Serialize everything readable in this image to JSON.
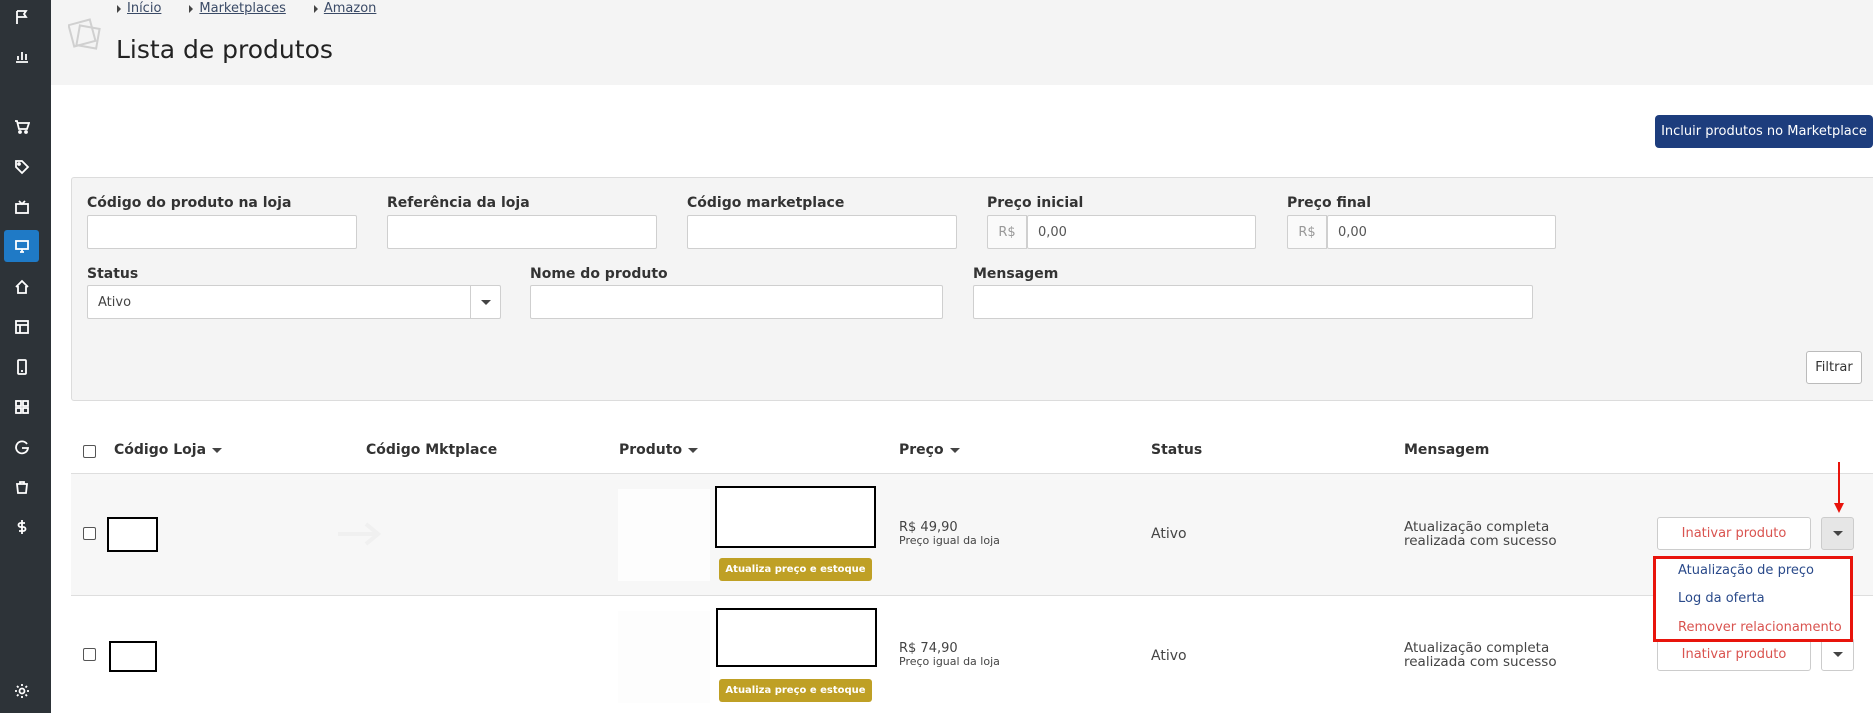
{
  "breadcrumb": [
    {
      "label": "Início"
    },
    {
      "label": "Marketplaces"
    },
    {
      "label": "Amazon"
    }
  ],
  "page_title": "Lista de produtos",
  "include_button": "Incluir produtos no Marketplace",
  "filters": {
    "store_code": {
      "label": "Código do produto na loja",
      "value": ""
    },
    "store_ref": {
      "label": "Referência da loja",
      "value": ""
    },
    "marketplace_code": {
      "label": "Código marketplace",
      "value": ""
    },
    "price_start": {
      "label": "Preço inicial",
      "prefix": "R$",
      "placeholder": "0,00"
    },
    "price_end": {
      "label": "Preço final",
      "prefix": "R$",
      "placeholder": "0,00"
    },
    "status": {
      "label": "Status",
      "value": "Ativo"
    },
    "product_name": {
      "label": "Nome do produto",
      "value": ""
    },
    "message": {
      "label": "Mensagem",
      "value": ""
    },
    "filter_button": "Filtrar"
  },
  "table": {
    "columns": [
      "Código Loja",
      "Código Mktplace",
      "Produto",
      "Preço",
      "Status",
      "Mensagem"
    ],
    "rows": [
      {
        "update_button": "Atualiza preço e estoque",
        "price": "R$ 49,90",
        "price_note": "Preço igual da loja",
        "status": "Ativo",
        "message": "Atualização completa realizada com sucesso",
        "inactivate_button": "Inativar produto"
      },
      {
        "update_button": "Atualiza preço e estoque",
        "price": "R$ 74,90",
        "price_note": "Preço igual da loja",
        "status": "Ativo",
        "message": "Atualização completa realizada com sucesso",
        "inactivate_button": "Inativar produto"
      }
    ]
  },
  "dropdown_menu": {
    "items": [
      "Atualização de preço",
      "Log da oferta",
      "Remover relacionamento"
    ]
  },
  "sidebar_icons": [
    "flag-icon",
    "bar-chart-icon",
    "cart-icon",
    "tag-icon",
    "tv-icon",
    "monitor-icon",
    "home-icon",
    "layout-icon",
    "mobile-icon",
    "grid-icon",
    "google-icon",
    "bag-icon",
    "dollar-icon",
    "settings-icon"
  ],
  "colors": {
    "sidebar": "#2d3338",
    "active_nav": "#1f7ac6",
    "primary_button": "#1d3d7d",
    "update_button": "#bfa025",
    "danger": "#d9534f",
    "annotation": "#e8140c"
  }
}
